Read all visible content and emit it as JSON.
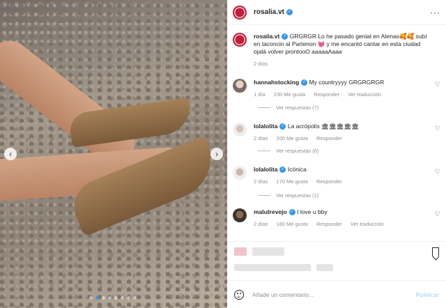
{
  "post": {
    "author": "rosalia.vt",
    "carousel": {
      "current_index": 1,
      "total": 8
    }
  },
  "caption": {
    "author": "rosalia.vt",
    "text": "GRGRGR Lo he pasado genial en Atenas🥰🥰 subí en taconcin al Partenon 💓 y me encantó cantar en esta ciudad ojalá volver prontooO aaaaaAaaa",
    "time": "2 días"
  },
  "comments": [
    {
      "user": "hannahstocking",
      "verified": true,
      "text": "My countryyyy GRGRGRGR",
      "time": "1 día",
      "likes": "230 Me gusta",
      "reply": "Responder",
      "translate": "Ver traducción",
      "replies": "Ver respuestas (7)"
    },
    {
      "user": "lolalolita",
      "verified": true,
      "text": "La acrópolis 🏛🏛🏛🏛🏛",
      "time": "2 días",
      "likes": "200 Me gusta",
      "reply": "Responder",
      "translate": "",
      "replies": "Ver respuestas (6)"
    },
    {
      "user": "lolalolita",
      "verified": true,
      "text": "Icónica",
      "time": "2 días",
      "likes": "170 Me gusta",
      "reply": "Responder",
      "translate": "",
      "replies": "Ver respuestas (1)"
    },
    {
      "user": "malutrevejo",
      "verified": true,
      "text": "I love u bby",
      "time": "2 días",
      "likes": "180 Me gusta",
      "reply": "Responder",
      "translate": "Ver traducción",
      "replies": ""
    }
  ],
  "add_comment": {
    "placeholder": "Añade un comentario...",
    "publish": "Publicar"
  },
  "icons": {
    "more": "more-options-icon",
    "heart": "heart-icon",
    "bookmark": "bookmark-icon",
    "emoji": "emoji-icon",
    "verified": "verified-badge-icon"
  },
  "colors": {
    "link_blue": "#3897f0",
    "muted": "#8e8e8e",
    "text": "#262626"
  }
}
